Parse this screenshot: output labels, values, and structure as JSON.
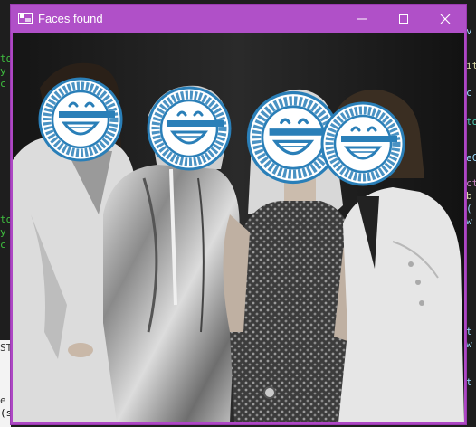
{
  "window": {
    "title": "Faces found",
    "controls": {
      "minimize": "minimize",
      "maximize": "maximize",
      "close": "close"
    }
  },
  "photo": {
    "description_icon": "grayscale-group-photo",
    "people_count": 4,
    "mask_ring_text": "I thought what I'd do was, I'd pretend I was one of those deaf-mutes",
    "mask_color": "#2a7fb8"
  },
  "background": {
    "left_fragments": [
      "to",
      "y",
      "c",
      "to",
      "y",
      "c",
      "ST",
      "e",
      "(s)"
    ],
    "right_fragments": [
      "v",
      "it",
      "c",
      "to",
      "eC",
      "ct",
      "b",
      "(",
      "w",
      "t",
      "w",
      "t"
    ]
  }
}
